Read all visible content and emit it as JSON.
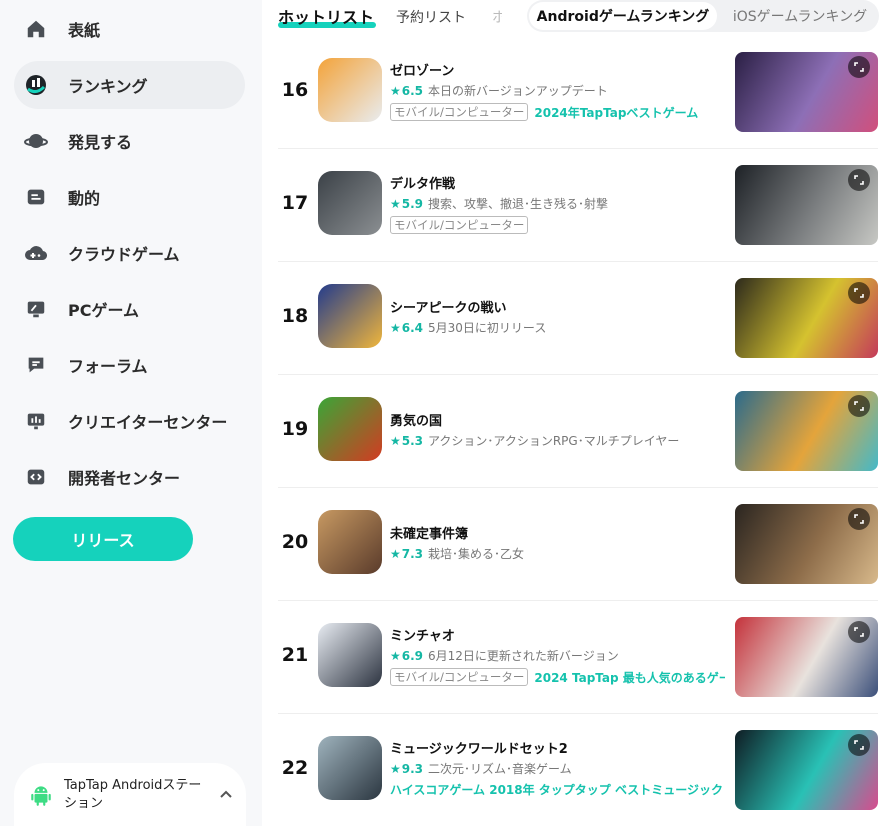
{
  "sidebar": {
    "items": [
      {
        "label": "表紙",
        "icon": "home-icon"
      },
      {
        "label": "ランキング",
        "icon": "ranking-icon"
      },
      {
        "label": "発見する",
        "icon": "planet-icon"
      },
      {
        "label": "動的",
        "icon": "feed-icon"
      },
      {
        "label": "クラウドゲーム",
        "icon": "cloud-game-icon"
      },
      {
        "label": "PCゲーム",
        "icon": "monitor-icon"
      },
      {
        "label": "フォーラム",
        "icon": "chat-icon"
      },
      {
        "label": "クリエイターセンター",
        "icon": "creator-icon"
      },
      {
        "label": "開発者センター",
        "icon": "code-icon"
      }
    ],
    "release_label": "リリース",
    "station_label": "TapTap Androidステーション"
  },
  "tabs": {
    "hot": "ホットリスト",
    "reserve": "予約リスト",
    "more": "ホ",
    "android": "Androidゲームランキング",
    "ios": "iOSゲームランキング"
  },
  "colors": {
    "accent": "#15d2bc",
    "score": "#15b7a4"
  },
  "games": [
    {
      "rank": "16",
      "name": "ゼロゾーン",
      "score": "6.5",
      "desc": "本日の新バージョンアップデート",
      "platform": "モバイル/コンピューター",
      "award": "2024年TapTapベストゲーム",
      "icon_colors": [
        "#f3a33a",
        "#e9ecef"
      ],
      "thumb_colors": [
        "#2a1f44",
        "#8d6fb6",
        "#d14f7c"
      ]
    },
    {
      "rank": "17",
      "name": "デルタ作戦",
      "score": "5.9",
      "desc": "捜索、攻撃、撤退･生き残る･射撃",
      "platform": "モバイル/コンピューター",
      "award": "",
      "icon_colors": [
        "#3b4147",
        "#8b8f92"
      ],
      "thumb_colors": [
        "#1d2126",
        "#7b7e80",
        "#c7c8c4"
      ]
    },
    {
      "rank": "18",
      "name": "シーアピークの戦い",
      "score": "6.4",
      "desc": "5月30日に初リリース",
      "platform": "",
      "award": "",
      "icon_colors": [
        "#233b8c",
        "#f0b63c"
      ],
      "thumb_colors": [
        "#2d2a1c",
        "#d5c22f",
        "#c43a5a"
      ]
    },
    {
      "rank": "19",
      "name": "勇気の国",
      "score": "5.3",
      "desc": "アクション･アクションRPG･マルチプレイヤー",
      "platform": "",
      "award": "",
      "icon_colors": [
        "#3aa637",
        "#d33b22"
      ],
      "thumb_colors": [
        "#2c6b8b",
        "#e4a43b",
        "#43b9c9"
      ]
    },
    {
      "rank": "20",
      "name": "未確定事件簿",
      "score": "7.3",
      "desc": "栽培･集める･乙女",
      "platform": "",
      "award": "",
      "icon_colors": [
        "#c79962",
        "#5a3b2b"
      ],
      "thumb_colors": [
        "#2a2520",
        "#8e6d4a",
        "#d8b98b"
      ]
    },
    {
      "rank": "21",
      "name": "ミンチャオ",
      "score": "6.9",
      "desc": "6月12日に更新された新バージョン",
      "platform": "モバイル/コンピューター",
      "award": "2024 TapTap 最も人気のあるゲー",
      "icon_colors": [
        "#e8ecf2",
        "#2c3340"
      ],
      "thumb_colors": [
        "#c4323b",
        "#e8e2dd",
        "#3b4f7a"
      ]
    },
    {
      "rank": "22",
      "name": "ミュージックワールドセット2",
      "score": "9.3",
      "desc": "二次元･リズム･音楽ゲーム",
      "platform": "",
      "award": "ハイスコアゲーム 2018年 タップタップ ベストミュージック",
      "icon_colors": [
        "#9fb3bd",
        "#2b3640"
      ],
      "thumb_colors": [
        "#0f1d24",
        "#29c1b5",
        "#d84b8e"
      ]
    }
  ]
}
